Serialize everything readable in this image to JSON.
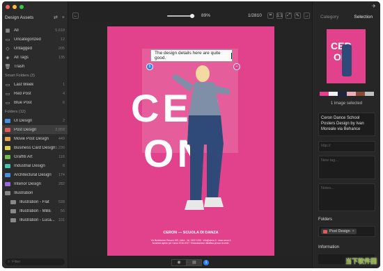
{
  "window": {
    "traffic_colors": [
      "#fc605c",
      "#fdbc40",
      "#34c84a"
    ]
  },
  "sidebar": {
    "title": "Design Assets",
    "library": [
      {
        "label": "All",
        "count": "5,618",
        "icon": "grid-icon"
      },
      {
        "label": "Uncategorized",
        "count": "12",
        "icon": "folder-outline-icon"
      },
      {
        "label": "Untagged",
        "count": "205",
        "icon": "tag-icon"
      },
      {
        "label": "All Tags",
        "count": "135",
        "icon": "tags-icon"
      },
      {
        "label": "Trash",
        "count": "",
        "icon": "trash-icon"
      }
    ],
    "smart_header": "Smart Folders (3)",
    "smart": [
      {
        "label": "Last Week",
        "count": "1"
      },
      {
        "label": "Red Post",
        "count": "4"
      },
      {
        "label": "Blue Post",
        "count": "6"
      }
    ],
    "folders_header": "Folders (12)",
    "folders": [
      {
        "label": "UI Design",
        "count": "2",
        "color": "#4a90e2"
      },
      {
        "label": "Post Design",
        "count": "2,858",
        "color": "#e25a5a",
        "selected": true
      },
      {
        "label": "Movie Post Design",
        "count": "449",
        "color": "#e2a34a"
      },
      {
        "label": "Business Card Design",
        "count": "1,236",
        "color": "#e2d24a"
      },
      {
        "label": "Graffiti Art",
        "count": "116",
        "color": "#6ac04a"
      },
      {
        "label": "Industrial Design",
        "count": "6",
        "color": "#4ac0b0"
      },
      {
        "label": "Architectural Design",
        "count": "174",
        "color": "#4a90e2"
      },
      {
        "label": "Interior Design",
        "count": "282",
        "color": "#9a6ae2"
      },
      {
        "label": "Illustration",
        "count": "",
        "color": "#888888"
      },
      {
        "label": "Illustration - Flat",
        "count": "528",
        "color": "#888888"
      },
      {
        "label": "Illustration - MBE",
        "count": "56",
        "color": "#888888"
      },
      {
        "label": "Illustration - Luca...",
        "count": "101",
        "color": "#888888"
      }
    ],
    "filter_placeholder": "Filter"
  },
  "toolbar": {
    "zoom": "89%",
    "zoom_fraction": 0.89,
    "pager": "1/2810"
  },
  "poster": {
    "title_top": "CER",
    "title_bottom": "ON",
    "footer": "CERON — SCUOLA DI DANZA",
    "small_line1": "Via Bortolomeo Rasura 100, Udine · tel. 0432 1234 · info@ceron.it · www.ceron.it",
    "small_line2": "Iscrizioni aperte per l'anno 2016-2017. Dimostrazione didattica presso la sede.",
    "bg": "#e2418b"
  },
  "annotation": {
    "text": "The design details here are quite good.",
    "pin1": "1",
    "pin2": "−"
  },
  "status": {
    "annotation_count": "1"
  },
  "rpanel": {
    "tab_category": "Category",
    "tab_selection": "Selection",
    "swatches": [
      "#e2418b",
      "#f0f0f0",
      "#1f2440",
      "#e8b0b8",
      "#8a4a3a",
      "#c0c0c0"
    ],
    "selected_info": "1 image selected",
    "title_text": "Ceron Dance School Posters Design by Ivan Moreale via Behance",
    "url_placeholder": "http://",
    "tag_placeholder": "New tag...",
    "notes_placeholder": "Notes...",
    "folders_label": "Folders",
    "folder_chip": "Post Design",
    "info_label": "Information"
  },
  "watermark": "当下软件园"
}
